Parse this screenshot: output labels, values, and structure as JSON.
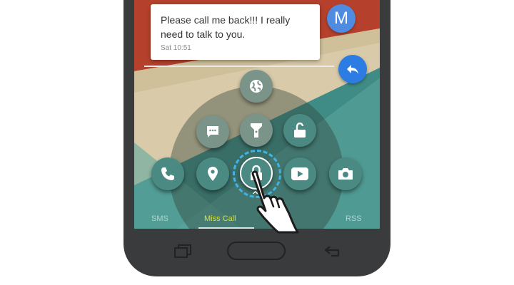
{
  "notification": {
    "message": "Please call me back!!! I really need to talk to you.",
    "time": "Sat 10:51",
    "avatar_letter": "M"
  },
  "colors": {
    "accent_blue": "#2c7ce3",
    "dial_button": "#4a8a82",
    "active_tab": "#d6e23a",
    "phone_body": "#3a3b3d"
  },
  "dial": {
    "buttons": [
      {
        "name": "globe-icon"
      },
      {
        "name": "message-icon"
      },
      {
        "name": "flashlight-icon"
      },
      {
        "name": "unlock-icon"
      },
      {
        "name": "phone-icon"
      },
      {
        "name": "location-pin-icon"
      },
      {
        "name": "lock-icon"
      },
      {
        "name": "play-icon"
      },
      {
        "name": "camera-icon"
      }
    ]
  },
  "tabs": [
    {
      "label": "SMS"
    },
    {
      "label": "Miss Call",
      "active": true
    },
    {
      "label": "RSS"
    }
  ]
}
